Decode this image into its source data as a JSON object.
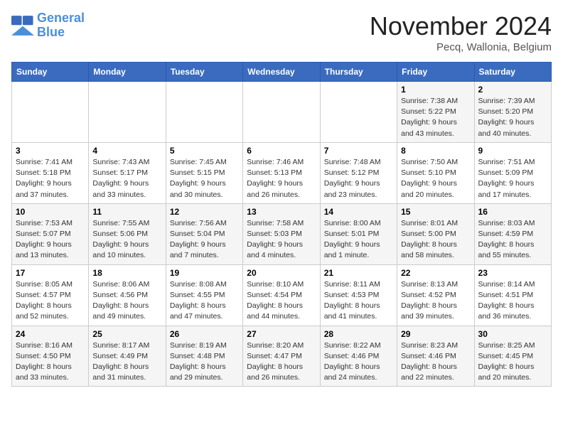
{
  "logo": {
    "line1": "General",
    "line2": "Blue"
  },
  "title": "November 2024",
  "subtitle": "Pecq, Wallonia, Belgium",
  "weekdays": [
    "Sunday",
    "Monday",
    "Tuesday",
    "Wednesday",
    "Thursday",
    "Friday",
    "Saturday"
  ],
  "weeks": [
    [
      {
        "day": "",
        "info": ""
      },
      {
        "day": "",
        "info": ""
      },
      {
        "day": "",
        "info": ""
      },
      {
        "day": "",
        "info": ""
      },
      {
        "day": "",
        "info": ""
      },
      {
        "day": "1",
        "info": "Sunrise: 7:38 AM\nSunset: 5:22 PM\nDaylight: 9 hours and 43 minutes."
      },
      {
        "day": "2",
        "info": "Sunrise: 7:39 AM\nSunset: 5:20 PM\nDaylight: 9 hours and 40 minutes."
      }
    ],
    [
      {
        "day": "3",
        "info": "Sunrise: 7:41 AM\nSunset: 5:18 PM\nDaylight: 9 hours and 37 minutes."
      },
      {
        "day": "4",
        "info": "Sunrise: 7:43 AM\nSunset: 5:17 PM\nDaylight: 9 hours and 33 minutes."
      },
      {
        "day": "5",
        "info": "Sunrise: 7:45 AM\nSunset: 5:15 PM\nDaylight: 9 hours and 30 minutes."
      },
      {
        "day": "6",
        "info": "Sunrise: 7:46 AM\nSunset: 5:13 PM\nDaylight: 9 hours and 26 minutes."
      },
      {
        "day": "7",
        "info": "Sunrise: 7:48 AM\nSunset: 5:12 PM\nDaylight: 9 hours and 23 minutes."
      },
      {
        "day": "8",
        "info": "Sunrise: 7:50 AM\nSunset: 5:10 PM\nDaylight: 9 hours and 20 minutes."
      },
      {
        "day": "9",
        "info": "Sunrise: 7:51 AM\nSunset: 5:09 PM\nDaylight: 9 hours and 17 minutes."
      }
    ],
    [
      {
        "day": "10",
        "info": "Sunrise: 7:53 AM\nSunset: 5:07 PM\nDaylight: 9 hours and 13 minutes."
      },
      {
        "day": "11",
        "info": "Sunrise: 7:55 AM\nSunset: 5:06 PM\nDaylight: 9 hours and 10 minutes."
      },
      {
        "day": "12",
        "info": "Sunrise: 7:56 AM\nSunset: 5:04 PM\nDaylight: 9 hours and 7 minutes."
      },
      {
        "day": "13",
        "info": "Sunrise: 7:58 AM\nSunset: 5:03 PM\nDaylight: 9 hours and 4 minutes."
      },
      {
        "day": "14",
        "info": "Sunrise: 8:00 AM\nSunset: 5:01 PM\nDaylight: 9 hours and 1 minute."
      },
      {
        "day": "15",
        "info": "Sunrise: 8:01 AM\nSunset: 5:00 PM\nDaylight: 8 hours and 58 minutes."
      },
      {
        "day": "16",
        "info": "Sunrise: 8:03 AM\nSunset: 4:59 PM\nDaylight: 8 hours and 55 minutes."
      }
    ],
    [
      {
        "day": "17",
        "info": "Sunrise: 8:05 AM\nSunset: 4:57 PM\nDaylight: 8 hours and 52 minutes."
      },
      {
        "day": "18",
        "info": "Sunrise: 8:06 AM\nSunset: 4:56 PM\nDaylight: 8 hours and 49 minutes."
      },
      {
        "day": "19",
        "info": "Sunrise: 8:08 AM\nSunset: 4:55 PM\nDaylight: 8 hours and 47 minutes."
      },
      {
        "day": "20",
        "info": "Sunrise: 8:10 AM\nSunset: 4:54 PM\nDaylight: 8 hours and 44 minutes."
      },
      {
        "day": "21",
        "info": "Sunrise: 8:11 AM\nSunset: 4:53 PM\nDaylight: 8 hours and 41 minutes."
      },
      {
        "day": "22",
        "info": "Sunrise: 8:13 AM\nSunset: 4:52 PM\nDaylight: 8 hours and 39 minutes."
      },
      {
        "day": "23",
        "info": "Sunrise: 8:14 AM\nSunset: 4:51 PM\nDaylight: 8 hours and 36 minutes."
      }
    ],
    [
      {
        "day": "24",
        "info": "Sunrise: 8:16 AM\nSunset: 4:50 PM\nDaylight: 8 hours and 33 minutes."
      },
      {
        "day": "25",
        "info": "Sunrise: 8:17 AM\nSunset: 4:49 PM\nDaylight: 8 hours and 31 minutes."
      },
      {
        "day": "26",
        "info": "Sunrise: 8:19 AM\nSunset: 4:48 PM\nDaylight: 8 hours and 29 minutes."
      },
      {
        "day": "27",
        "info": "Sunrise: 8:20 AM\nSunset: 4:47 PM\nDaylight: 8 hours and 26 minutes."
      },
      {
        "day": "28",
        "info": "Sunrise: 8:22 AM\nSunset: 4:46 PM\nDaylight: 8 hours and 24 minutes."
      },
      {
        "day": "29",
        "info": "Sunrise: 8:23 AM\nSunset: 4:46 PM\nDaylight: 8 hours and 22 minutes."
      },
      {
        "day": "30",
        "info": "Sunrise: 8:25 AM\nSunset: 4:45 PM\nDaylight: 8 hours and 20 minutes."
      }
    ]
  ]
}
